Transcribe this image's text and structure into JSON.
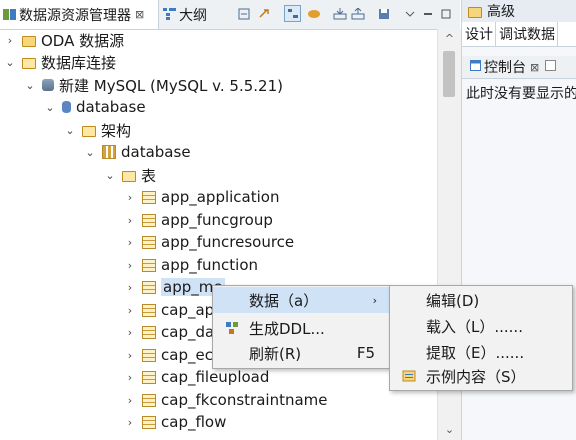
{
  "left_tabs": {
    "explorer": "数据源资源管理器",
    "close": "⊠",
    "outline": "大纲"
  },
  "tree": [
    {
      "label": "ODA 数据源",
      "chev": "›",
      "icon": "folder"
    },
    {
      "label": "数据库连接",
      "chev": "⌄",
      "icon": "folder-open"
    },
    {
      "label": "新建 MySQL (MySQL v. 5.5.21)",
      "chev": "⌄",
      "icon": "dbsrv"
    },
    {
      "label": "database",
      "chev": "⌄",
      "icon": "db"
    },
    {
      "label": "架构",
      "chev": "⌄",
      "icon": "folder-open"
    },
    {
      "label": "database",
      "chev": "⌄",
      "icon": "schema"
    },
    {
      "label": "表",
      "chev": "⌄",
      "icon": "folder-open"
    },
    {
      "label": "app_application",
      "chev": "›",
      "icon": "table"
    },
    {
      "label": "app_funcgroup",
      "chev": "›",
      "icon": "table"
    },
    {
      "label": "app_funcresource",
      "chev": "›",
      "icon": "table"
    },
    {
      "label": "app_function",
      "chev": "›",
      "icon": "table"
    },
    {
      "label": "app_me",
      "chev": "›",
      "icon": "table"
    },
    {
      "label": "cap_ap",
      "chev": "›",
      "icon": "table"
    },
    {
      "label": "cap_da",
      "chev": "›",
      "icon": "table"
    },
    {
      "label": "cap_ec",
      "chev": "›",
      "icon": "table"
    },
    {
      "label": "cap_fileupload",
      "chev": "›",
      "icon": "table"
    },
    {
      "label": "cap_fkconstraintname",
      "chev": "›",
      "icon": "table"
    },
    {
      "label": "cap_flow",
      "chev": "›",
      "icon": "table"
    }
  ],
  "right_panel": {
    "header": "高级",
    "tabs": [
      "设计",
      "调试数据"
    ],
    "console_tab": "控制台",
    "console_close": "⊠",
    "console_text": "此时没有要显示的"
  },
  "context_menu": {
    "items": [
      {
        "label": "数据（a）",
        "accel": "",
        "submenu": true
      },
      {
        "label": "生成DDL...",
        "accel": ""
      },
      {
        "label": "刷新(R)",
        "accel": "F5"
      }
    ]
  },
  "submenu": {
    "items": [
      {
        "label": "编辑(D)"
      },
      {
        "label": "载入（L）......"
      },
      {
        "label": "提取（E）......"
      },
      {
        "label": "示例内容（S）"
      }
    ]
  }
}
